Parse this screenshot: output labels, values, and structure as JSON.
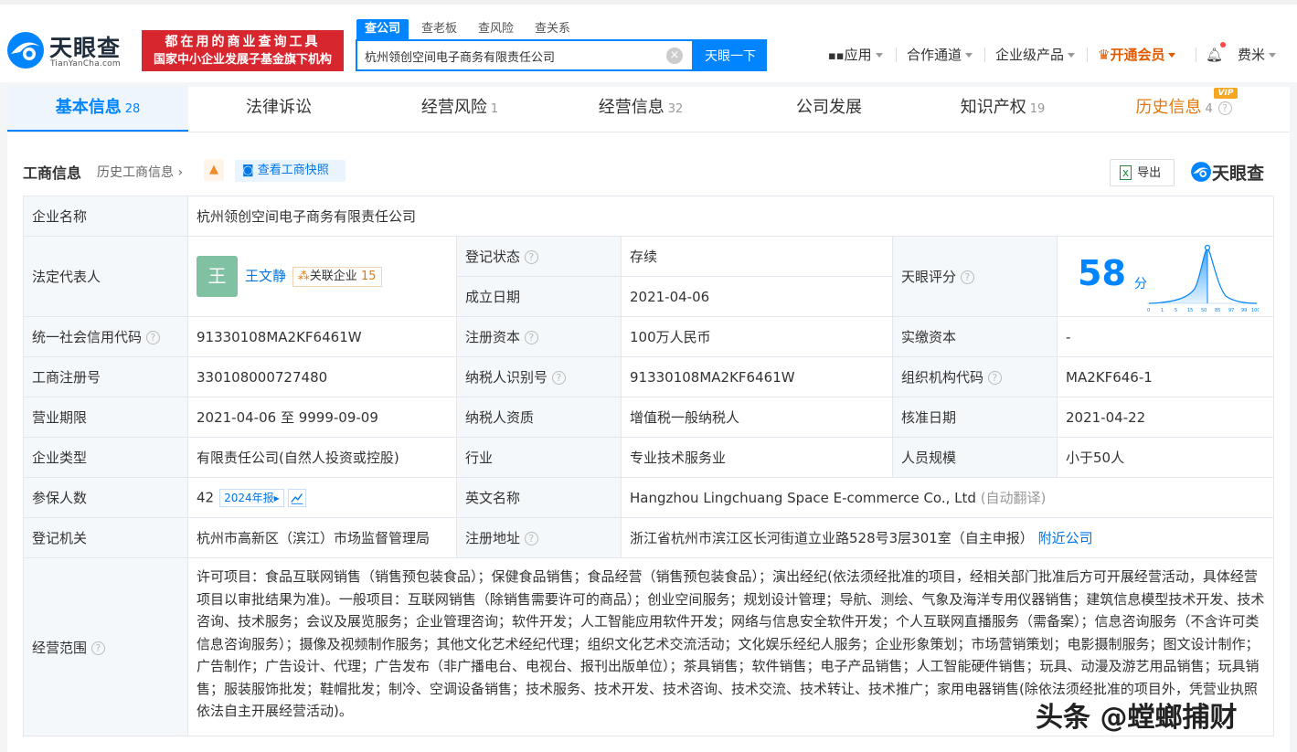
{
  "header": {
    "logo_cn": "天眼查",
    "logo_en": "TianYanCha.com",
    "slogan_line1": "都在用的商业查询工具",
    "slogan_line2": "国家中小企业发展子基金旗下机构",
    "search_tabs": [
      "查公司",
      "查老板",
      "查风险",
      "查关系"
    ],
    "search_value": "杭州领创空间电子商务有限责任公司",
    "search_button": "天眼一下",
    "nav": {
      "apps": "应用",
      "channel": "合作通道",
      "enterprise": "企业级产品",
      "vip": "开通会员",
      "user": "费米"
    }
  },
  "tabs": [
    {
      "label": "基本信息",
      "count": "28"
    },
    {
      "label": "法律诉讼",
      "count": ""
    },
    {
      "label": "经营风险",
      "count": "1"
    },
    {
      "label": "经营信息",
      "count": "32"
    },
    {
      "label": "公司发展",
      "count": ""
    },
    {
      "label": "知识产权",
      "count": "19"
    },
    {
      "label": "历史信息",
      "count": "4"
    }
  ],
  "vip_badge": "VIP",
  "section": {
    "title": "工商信息",
    "history_link": "历史工商信息",
    "snapshot_button": "查看工商快照",
    "export_button": "导出",
    "brand": "天眼查"
  },
  "info": {
    "company_name_label": "企业名称",
    "company_name": "杭州领创空间电子商务有限责任公司",
    "legal_rep_label": "法定代表人",
    "legal_rep_avatar": "王",
    "legal_rep": "王文静",
    "related_label": "关联企业",
    "related_count": "15",
    "reg_status_label": "登记状态",
    "reg_status": "存续",
    "est_date_label": "成立日期",
    "est_date": "2021-04-06",
    "score_label": "天眼评分",
    "score": "58",
    "score_unit": "分",
    "credit_code_label": "统一社会信用代码",
    "credit_code": "91330108MA2KF6461W",
    "reg_capital_label": "注册资本",
    "reg_capital": "100万人民币",
    "paid_capital_label": "实缴资本",
    "paid_capital": "-",
    "reg_no_label": "工商注册号",
    "reg_no": "330108000727480",
    "tax_id_label": "纳税人识别号",
    "tax_id": "91330108MA2KF6461W",
    "org_code_label": "组织机构代码",
    "org_code": "MA2KF646-1",
    "term_label": "营业期限",
    "term": "2021-04-06 至 9999-09-09",
    "tax_qual_label": "纳税人资质",
    "tax_qual": "增值税一般纳税人",
    "approve_date_label": "核准日期",
    "approve_date": "2021-04-22",
    "type_label": "企业类型",
    "type": "有限责任公司(自然人投资或控股)",
    "industry_label": "行业",
    "industry": "专业技术服务业",
    "staff_label": "人员规模",
    "staff": "小于50人",
    "insured_label": "参保人数",
    "insured": "42",
    "report_badge": "2024年报",
    "en_name_label": "英文名称",
    "en_name": "Hangzhou Lingchuang Space E-commerce Co., Ltd",
    "auto_translate": "(自动翻译)",
    "authority_label": "登记机关",
    "authority": "杭州市高新区（滨江）市场监督管理局",
    "address_label": "注册地址",
    "address": "浙江省杭州市滨江区长河街道立业路528号3层301室（自主申报）",
    "nearby_link": "附近公司",
    "scope_label": "经营范围",
    "scope": "许可项目：食品互联网销售（销售预包装食品）；保健食品销售；食品经营（销售预包装食品）；演出经纪(依法须经批准的项目，经相关部门批准后方可开展经营活动，具体经营项目以审批结果为准)。一般项目：互联网销售（除销售需要许可的商品）；创业空间服务；规划设计管理；导航、测绘、气象及海洋专用仪器销售；建筑信息模型技术开发、技术咨询、技术服务；会议及展览服务；企业管理咨询；软件开发；人工智能应用软件开发；网络与信息安全软件开发；个人互联网直播服务（需备案）；信息咨询服务（不含许可类信息咨询服务）；摄像及视频制作服务；其他文化艺术经纪代理；组织文化艺术交流活动；文化娱乐经纪人服务；企业形象策划；市场营销策划；电影摄制服务；图文设计制作；广告制作；广告设计、代理；广告发布（非广播电台、电视台、报刊出版单位）；茶具销售；软件销售；电子产品销售；人工智能硬件销售；玩具、动漫及游艺用品销售；玩具销售；服装服饰批发；鞋帽批发；制冷、空调设备销售；技术服务、技术开发、技术咨询、技术交流、技术转让、技术推广；家用电器销售(除依法须经批准的项目外，凭营业执照依法自主开展经营活动)。"
  },
  "score_axis": [
    "0",
    "1",
    "5",
    "15",
    "50",
    "85",
    "97",
    "99",
    "100"
  ],
  "watermark": "头条 @螳螂捕财",
  "colors": {
    "accent": "#0084ff",
    "brand_red": "#d8262e",
    "status_green": "#2aa84a",
    "vip_orange": "#e07a10"
  }
}
